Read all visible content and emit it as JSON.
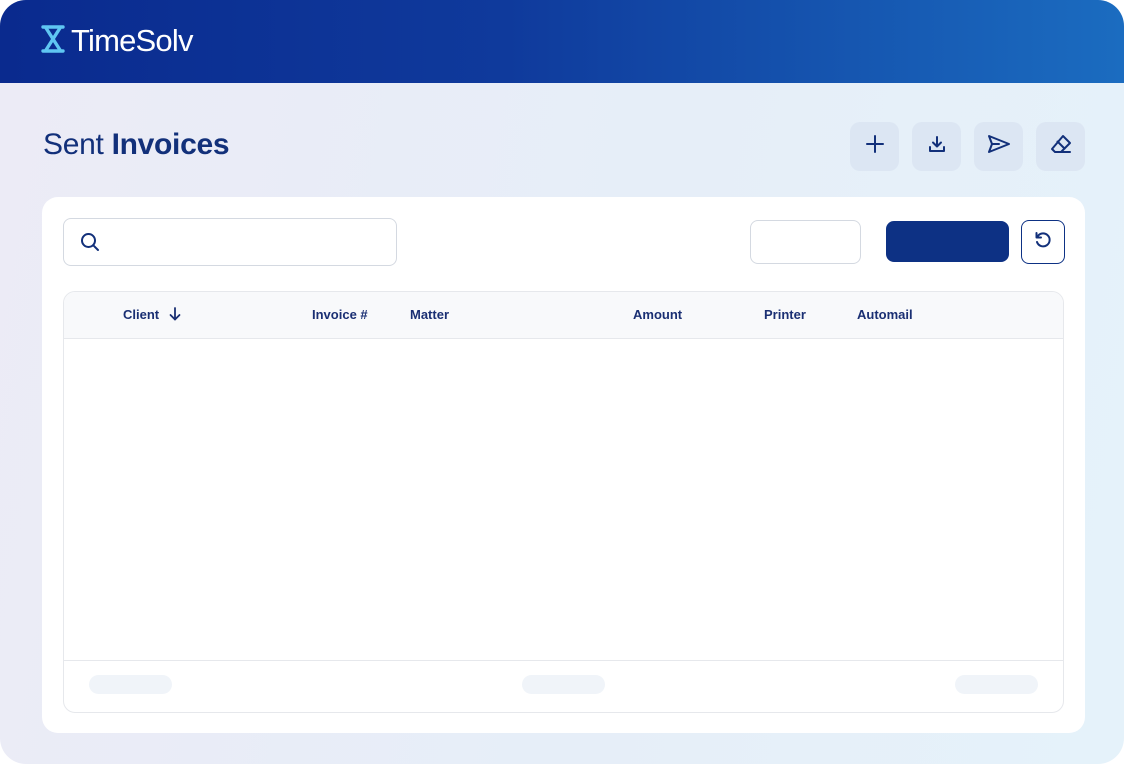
{
  "app": {
    "name": "TimeSolv",
    "brand_color": "#0d3184"
  },
  "page": {
    "title_light": "Sent",
    "title_bold": "Invoices"
  },
  "toolbar": {
    "buttons": [
      {
        "icon": "plus-icon"
      },
      {
        "icon": "download-icon"
      },
      {
        "icon": "send-icon"
      },
      {
        "icon": "eraser-icon"
      }
    ]
  },
  "search": {
    "icon": "search-icon",
    "placeholder": "",
    "value": ""
  },
  "table": {
    "columns": [
      {
        "label": "Client",
        "sort_icon": "arrow-down-icon"
      },
      {
        "label": "Invoice #"
      },
      {
        "label": "Matter"
      },
      {
        "label": "Amount"
      },
      {
        "label": "Printer"
      },
      {
        "label": "Automail"
      }
    ],
    "rows": []
  }
}
